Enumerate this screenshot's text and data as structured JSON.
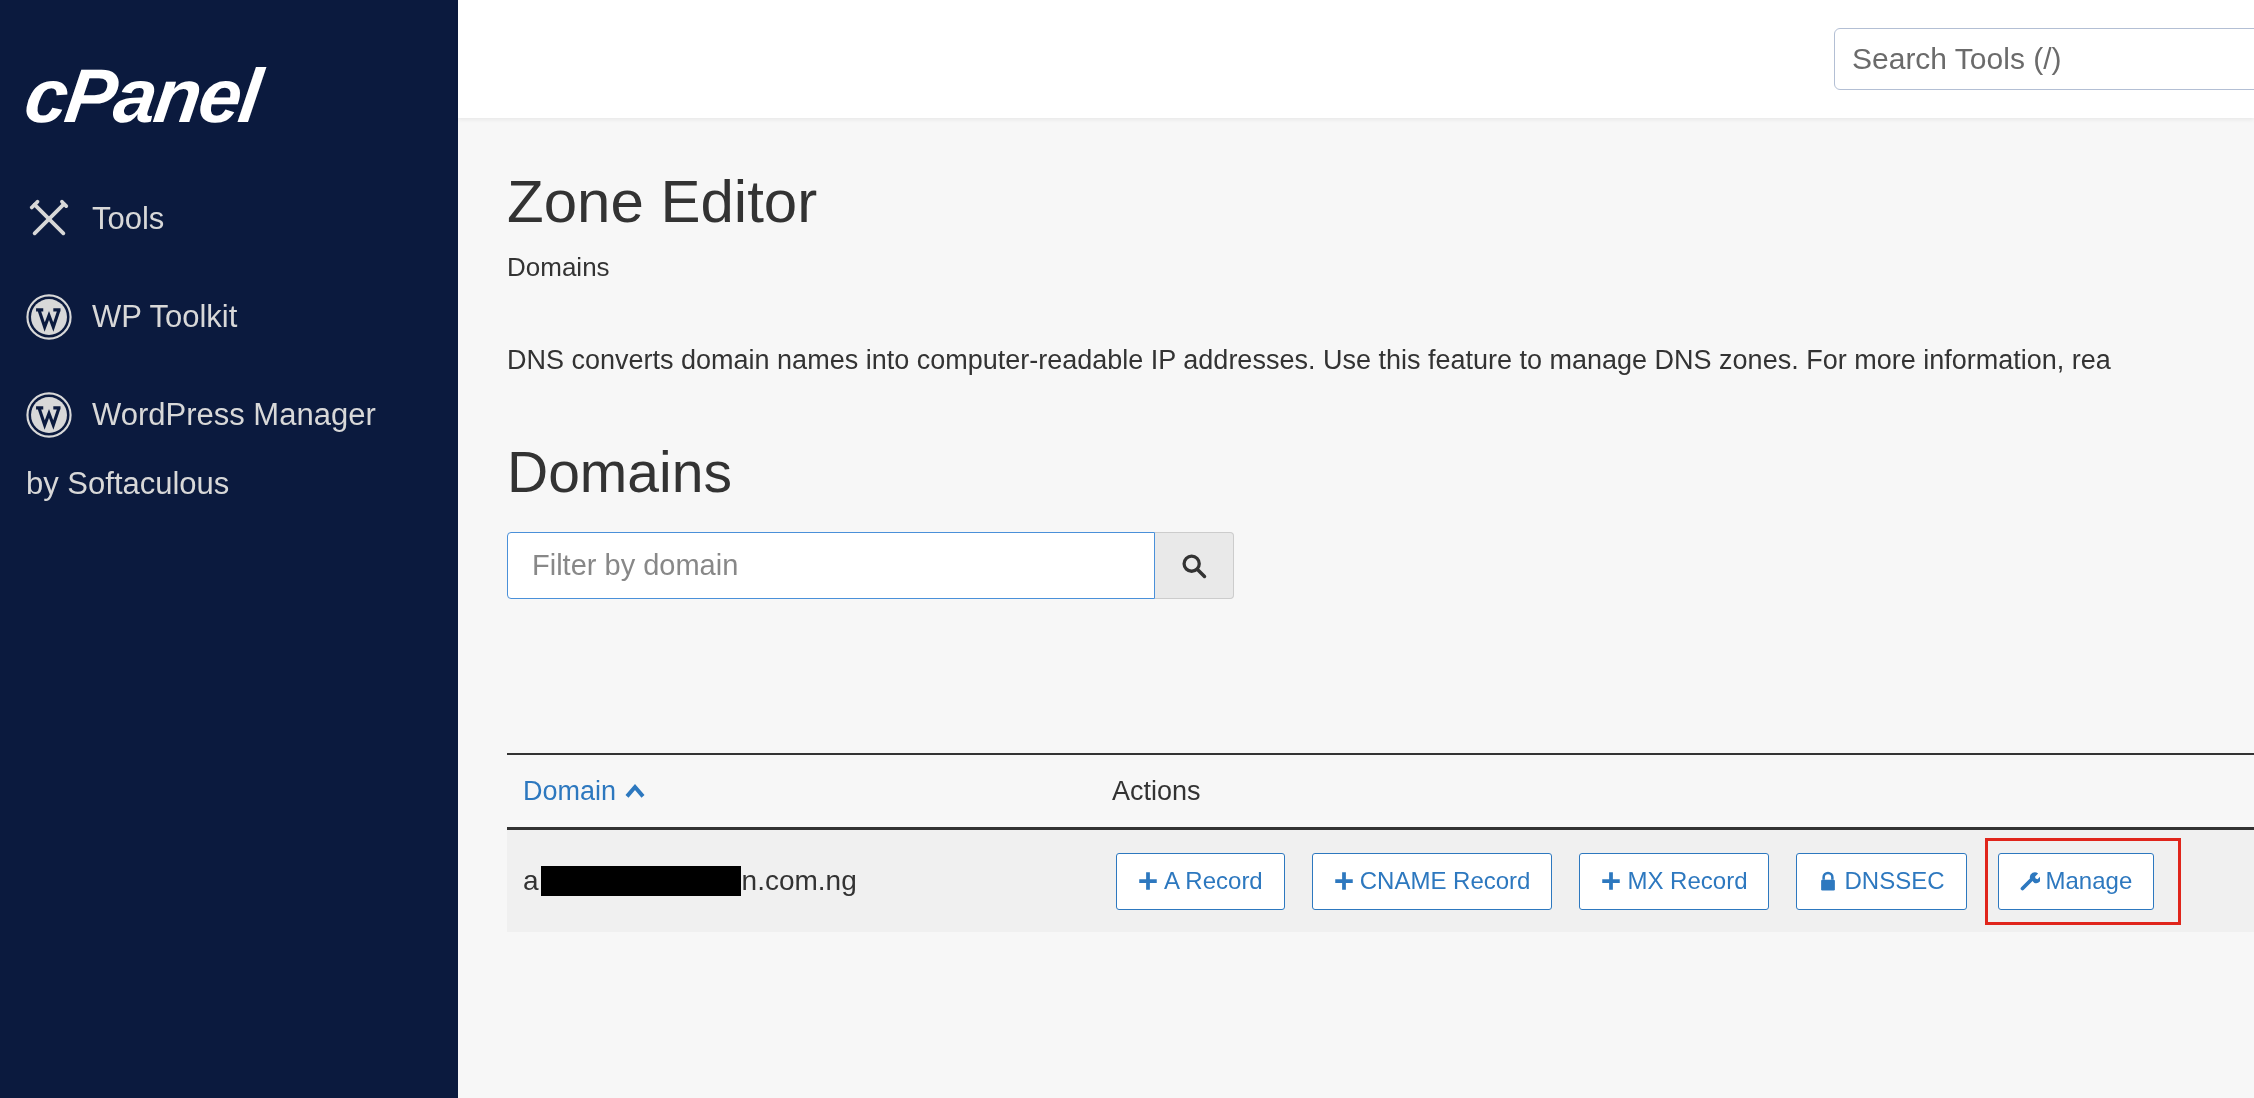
{
  "sidebar": {
    "logo": "cPanel",
    "items": [
      {
        "label": "Tools",
        "kind": "tools",
        "selected": false
      },
      {
        "label": "WP Toolkit",
        "kind": "wordpress",
        "selected": false
      },
      {
        "label": "WordPress Manager",
        "kind": "wordpress",
        "selected": false,
        "sublabel": "by Softaculous"
      }
    ]
  },
  "header": {
    "search": {
      "placeholder": "Search Tools (/)"
    }
  },
  "page": {
    "title": "Zone Editor",
    "breadcrumb": "Domains",
    "description": "DNS converts domain names into computer-readable IP addresses. Use this feature to manage DNS zones. For more information, rea"
  },
  "section": {
    "title": "Domains",
    "filter": {
      "placeholder": "Filter by domain"
    }
  },
  "table": {
    "columns": [
      {
        "label": "Domain",
        "sorted": true
      },
      {
        "label": "Actions",
        "sorted": false
      }
    ],
    "rows": [
      {
        "domain_start": "a",
        "redacted": true,
        "domain_end": "n.com.ng",
        "actions": [
          {
            "label": "A Record",
            "kind": "add",
            "highlighted": false
          },
          {
            "label": "CNAME Record",
            "kind": "add",
            "highlighted": false
          },
          {
            "label": "MX Record",
            "kind": "add",
            "highlighted": false
          },
          {
            "label": "DNSSEC",
            "kind": "security",
            "highlighted": false
          },
          {
            "label": "Manage",
            "kind": "manage",
            "highlighted": true
          }
        ]
      }
    ]
  }
}
